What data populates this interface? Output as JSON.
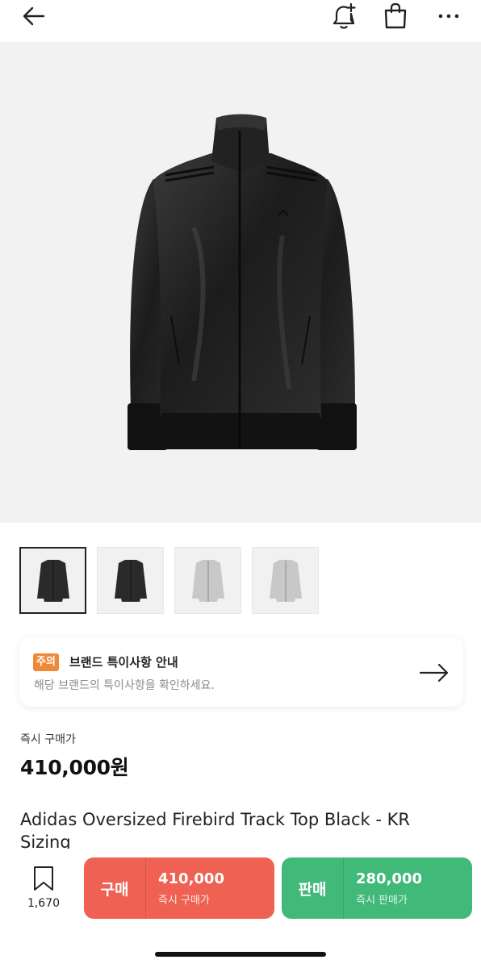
{
  "header": {
    "back_icon": "arrow-left-icon",
    "bell_icon": "bell-plus-icon",
    "bag_icon": "shopping-bag-icon",
    "more_icon": "more-horizontal-icon"
  },
  "gallery": {
    "thumbnails": [
      {
        "color": "#2a2a2a",
        "selected": true
      },
      {
        "color": "#2a2a2a",
        "selected": false
      },
      {
        "color": "#c8c8c8",
        "selected": false
      },
      {
        "color": "#c8c8c8",
        "selected": false
      }
    ]
  },
  "notice": {
    "badge": "주의",
    "title": "브랜드 특이사항 안내",
    "description": "해당 브랜드의 특이사항을 확인하세요."
  },
  "price": {
    "label": "즉시 구매가",
    "value": "410,000원"
  },
  "product": {
    "name": "Adidas Oversized Firebird Track Top Black - KR Sizing"
  },
  "bottom_bar": {
    "wish_count": "1,670",
    "buy": {
      "kind": "구매",
      "amount": "410,000",
      "sub": "즉시 구매가",
      "color": "#ef6253"
    },
    "sell": {
      "kind": "판매",
      "amount": "280,000",
      "sub": "즉시 판매가",
      "color": "#41b979"
    }
  }
}
